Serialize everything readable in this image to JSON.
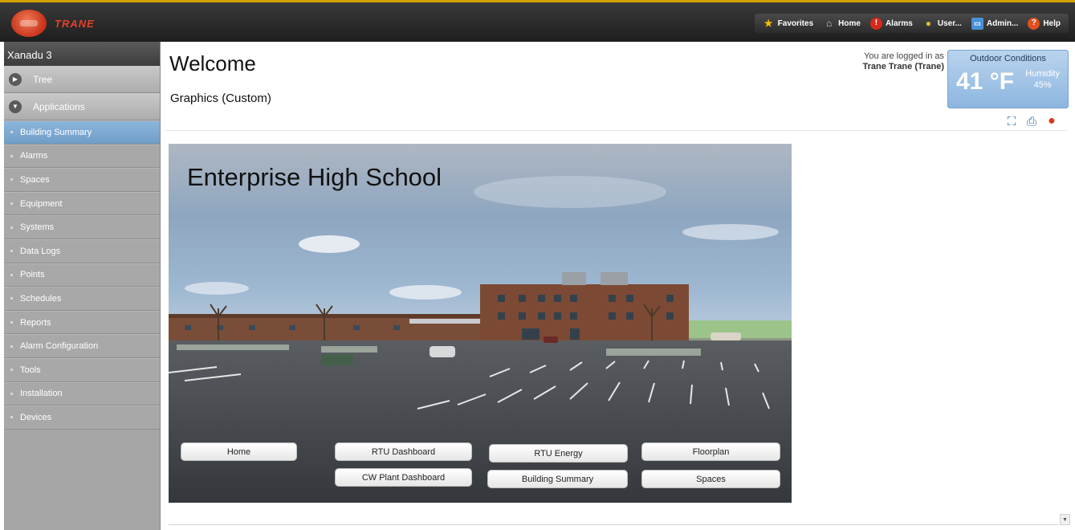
{
  "topbar": {
    "brand": "TRANE",
    "nav": [
      {
        "label": "Favorites",
        "icon": "star-icon"
      },
      {
        "label": "Home",
        "icon": "home-icon"
      },
      {
        "label": "Alarms",
        "icon": "alarm-icon"
      },
      {
        "label": "User...",
        "icon": "user-icon"
      },
      {
        "label": "Admin...",
        "icon": "admin-icon"
      },
      {
        "label": "Help",
        "icon": "help-icon"
      }
    ]
  },
  "sidebar": {
    "site_name": "Xanadu 3",
    "sections": [
      {
        "label": "Tree",
        "icon": "chevron-right-icon"
      },
      {
        "label": "Applications",
        "icon": "chevron-down-icon"
      }
    ],
    "items": [
      {
        "label": "Building Summary",
        "active": true
      },
      {
        "label": "Alarms"
      },
      {
        "label": "Spaces"
      },
      {
        "label": "Equipment"
      },
      {
        "label": "Systems"
      },
      {
        "label": "Data Logs"
      },
      {
        "label": "Points"
      },
      {
        "label": "Schedules"
      },
      {
        "label": "Reports"
      },
      {
        "label": "Alarm Configuration"
      },
      {
        "label": "Tools"
      },
      {
        "label": "Installation"
      },
      {
        "label": "Devices"
      }
    ]
  },
  "main": {
    "title": "Welcome",
    "subtitle": "Graphics (Custom)",
    "login_line1": "You are logged in as",
    "login_user": "Trane Trane (Trane)",
    "outdoor": {
      "title": "Outdoor Conditions",
      "temperature": "41 °F",
      "humidity_label": "Humidity",
      "humidity_value": "45%"
    },
    "tools": [
      "fullscreen-icon",
      "print-icon",
      "flag-icon"
    ],
    "graphic": {
      "title": "Enterprise High School",
      "buttons": {
        "home": "Home",
        "rtu_dashboard": "RTU Dashboard",
        "rtu_energy": "RTU Energy",
        "floorplan": "Floorplan",
        "cw_plant": "CW Plant Dashboard",
        "building_summary": "Building Summary",
        "spaces": "Spaces"
      }
    }
  },
  "colors": {
    "topbar": "#2a2a2a",
    "sidebar": "#a6a6a6",
    "active_item": "#7aa6d2",
    "outdoor_panel": "#a4c6e8",
    "brand_red": "#e2402a"
  }
}
